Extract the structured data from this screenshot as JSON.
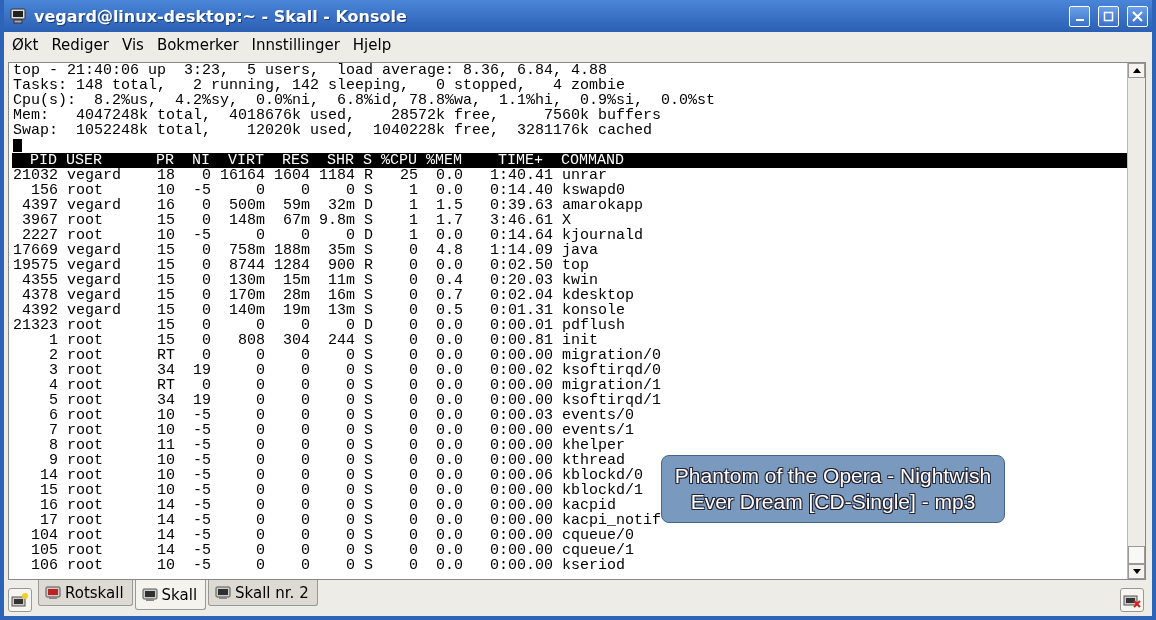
{
  "window": {
    "title": "vegard@linux-desktop:~ - Skall - Konsole"
  },
  "menu": [
    "Økt",
    "Rediger",
    "Vis",
    "Bokmerker",
    "Innstillinger",
    "Hjelp"
  ],
  "terminal": {
    "summary": [
      "top - 21:40:06 up  3:23,  5 users,  load average: 8.36, 6.84, 4.88",
      "Tasks: 148 total,   2 running, 142 sleeping,   0 stopped,   4 zombie",
      "Cpu(s):  8.2%us,  4.2%sy,  0.0%ni,  6.8%id, 78.8%wa,  1.1%hi,  0.9%si,  0.0%st",
      "Mem:   4047248k total,  4018676k used,    28572k free,     7560k buffers",
      "Swap:  1052248k total,    12020k used,  1040228k free,  3281176k cached"
    ],
    "header": "  PID USER      PR  NI  VIRT  RES  SHR S %CPU %MEM    TIME+  COMMAND",
    "rows": [
      "21032 vegard    18   0 16164 1604 1184 R   25  0.0   1:40.41 unrar",
      "  156 root      10  -5     0    0    0 S    1  0.0   0:14.40 kswapd0",
      " 4397 vegard    16   0  500m  59m  32m D    1  1.5   0:39.63 amarokapp",
      " 3967 root      15   0  148m  67m 9.8m S    1  1.7   3:46.61 X",
      " 2227 root      10  -5     0    0    0 D    1  0.0   0:14.64 kjournald",
      "17669 vegard    15   0  758m 188m  35m S    0  4.8   1:14.09 java",
      "19575 vegard    15   0  8744 1284  900 R    0  0.0   0:02.50 top",
      " 4355 vegard    15   0  130m  15m  11m S    0  0.4   0:20.03 kwin",
      " 4378 vegard    15   0  170m  28m  16m S    0  0.7   0:02.04 kdesktop",
      " 4392 vegard    15   0  140m  19m  13m S    0  0.5   0:01.31 konsole",
      "21323 root      15   0     0    0    0 D    0  0.0   0:00.01 pdflush",
      "    1 root      15   0   808  304  244 S    0  0.0   0:00.81 init",
      "    2 root      RT   0     0    0    0 S    0  0.0   0:00.00 migration/0",
      "    3 root      34  19     0    0    0 S    0  0.0   0:00.02 ksoftirqd/0",
      "    4 root      RT   0     0    0    0 S    0  0.0   0:00.00 migration/1",
      "    5 root      34  19     0    0    0 S    0  0.0   0:00.00 ksoftirqd/1",
      "    6 root      10  -5     0    0    0 S    0  0.0   0:00.03 events/0",
      "    7 root      10  -5     0    0    0 S    0  0.0   0:00.00 events/1",
      "    8 root      11  -5     0    0    0 S    0  0.0   0:00.00 khelper",
      "    9 root      10  -5     0    0    0 S    0  0.0   0:00.00 kthread",
      "   14 root      10  -5     0    0    0 S    0  0.0   0:00.06 kblockd/0",
      "   15 root      10  -5     0    0    0 S    0  0.0   0:00.00 kblockd/1",
      "   16 root      14  -5     0    0    0 S    0  0.0   0:00.00 kacpid",
      "   17 root      14  -5     0    0    0 S    0  0.0   0:00.00 kacpi_notif",
      "  104 root      14  -5     0    0    0 S    0  0.0   0:00.00 cqueue/0",
      "  105 root      14  -5     0    0    0 S    0  0.0   0:00.00 cqueue/1",
      "  106 root      10  -5     0    0    0 S    0  0.0   0:00.00 kseriod"
    ]
  },
  "notification": {
    "lines": [
      "Phantom of the Opera - Nightwish",
      "Ever Dream [CD-Single] - mp3"
    ]
  },
  "tabs": [
    {
      "label": "Rotskall",
      "kind": "root",
      "selected": false
    },
    {
      "label": "Skall",
      "kind": "shell",
      "selected": true
    },
    {
      "label": "Skall nr. 2",
      "kind": "shell",
      "selected": false
    }
  ]
}
